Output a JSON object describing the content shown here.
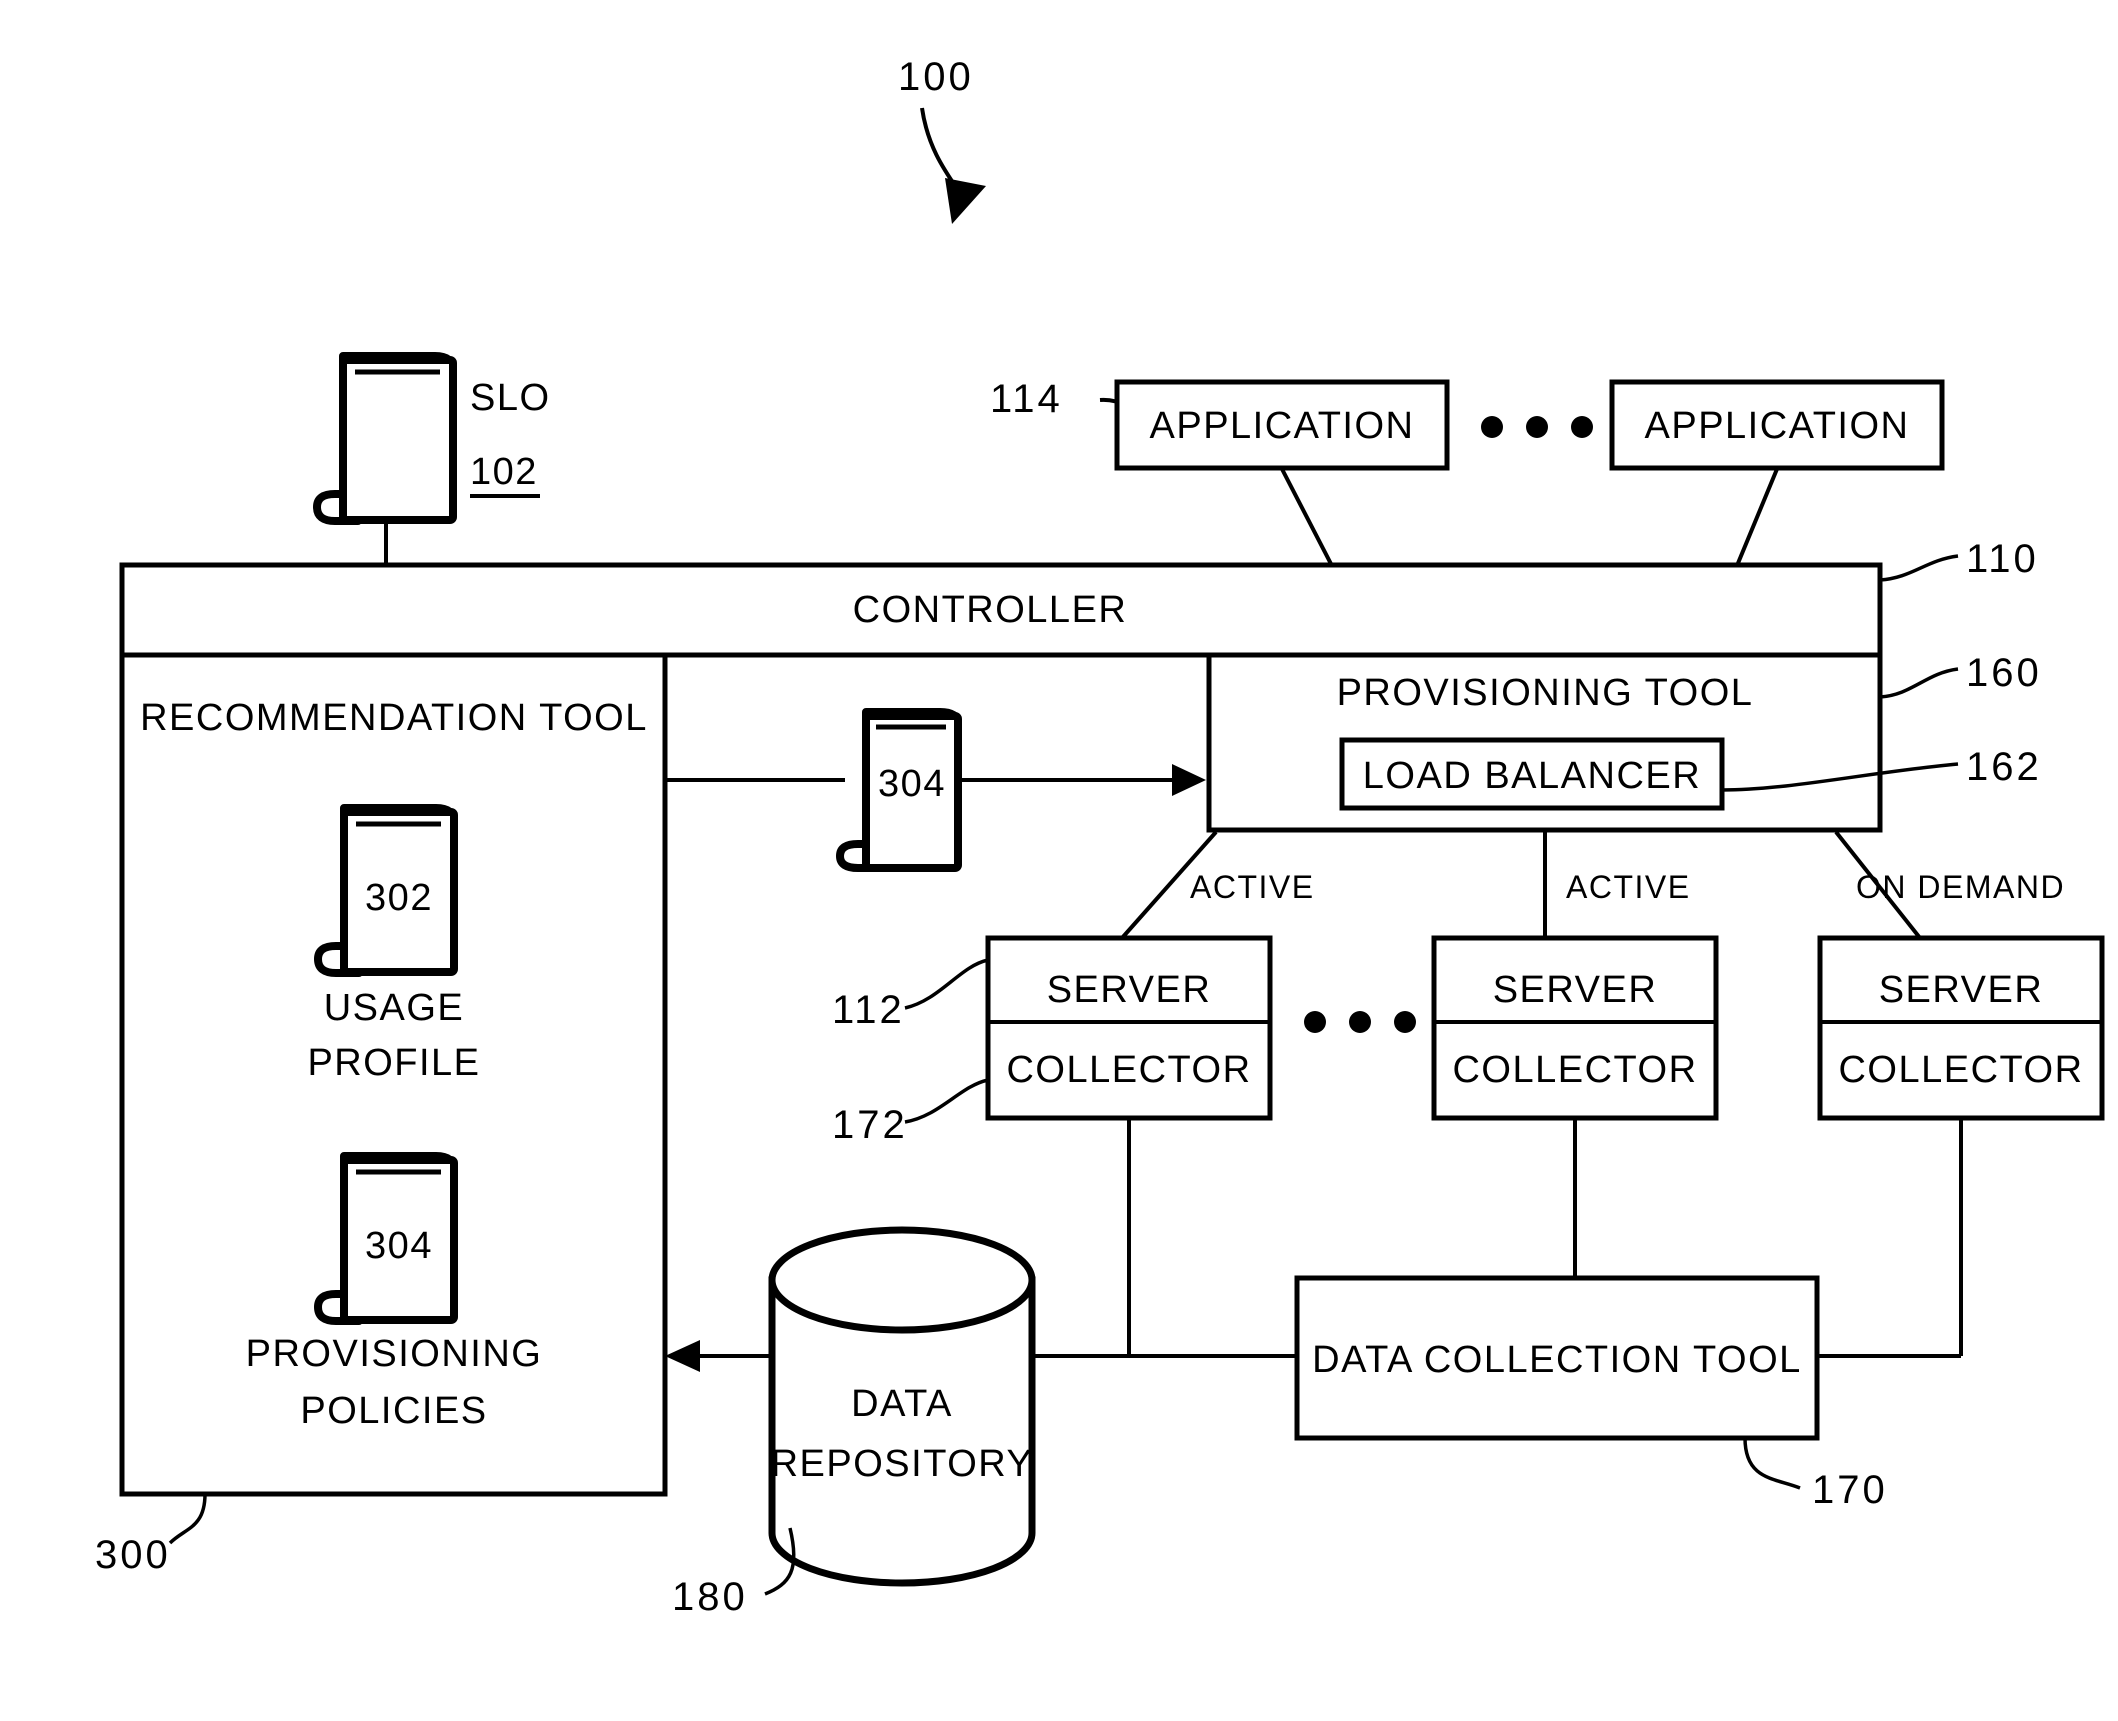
{
  "figure": {
    "number": "100",
    "title": "System architecture diagram"
  },
  "refs": {
    "slo": "102",
    "controller": "110",
    "server": "112",
    "application": "114",
    "provisioning_tool": "160",
    "load_balancer": "162",
    "data_collection_tool": "170",
    "collector": "172",
    "data_repository": "180",
    "recommendation_tool": "300",
    "usage_profile": "302",
    "provisioning_policies": "304",
    "provisioning_policies_mid": "304"
  },
  "labels": {
    "slo": "SLO",
    "controller": "CONTROLLER",
    "recommendation_tool": "RECOMMENDATION TOOL",
    "usage_profile_line1": "USAGE",
    "usage_profile_line2": "PROFILE",
    "provisioning_policies_line1": "PROVISIONING",
    "provisioning_policies_line2": "POLICIES",
    "application_1": "APPLICATION",
    "application_2": "APPLICATION",
    "provisioning_tool": "PROVISIONING TOOL",
    "load_balancer": "LOAD BALANCER",
    "server_1": "SERVER",
    "server_2": "SERVER",
    "server_3": "SERVER",
    "collector_1": "COLLECTOR",
    "collector_2": "COLLECTOR",
    "collector_3": "COLLECTOR",
    "state_1": "ACTIVE",
    "state_2": "ACTIVE",
    "state_3": "ON DEMAND",
    "data_repository_line1": "DATA",
    "data_repository_line2": "REPOSITORY",
    "data_collection_tool": "DATA COLLECTION TOOL"
  },
  "colors": {
    "stroke": "#000000",
    "fill": "#ffffff"
  }
}
